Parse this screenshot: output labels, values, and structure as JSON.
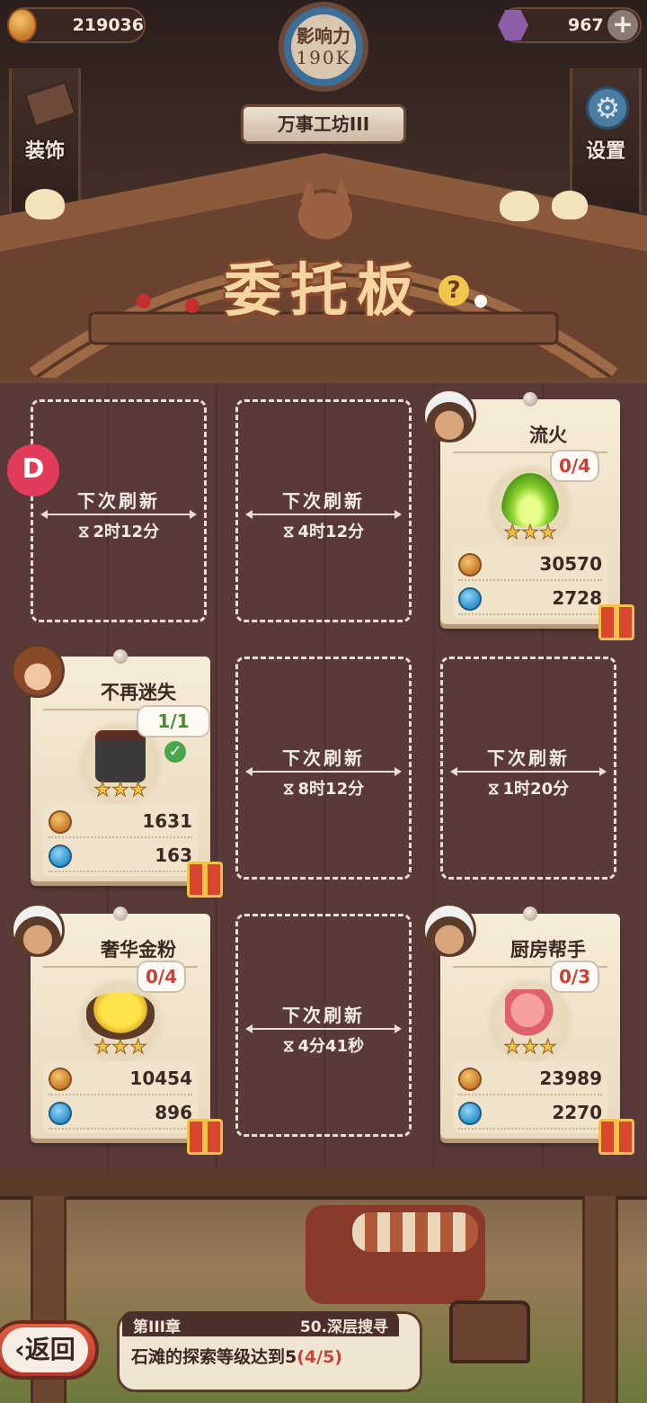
{
  "header": {
    "gold": "219036",
    "gems": "967",
    "influence_label": "影响力",
    "influence_value": "190K",
    "workshop_name": "万事工坊III",
    "decor_label": "装饰",
    "settings_label": "设置"
  },
  "board": {
    "title": "委托板",
    "help_icon": "?"
  },
  "slots": [
    {
      "type": "empty",
      "refresh_label": "下次刷新",
      "time": "2时12分"
    },
    {
      "type": "empty",
      "refresh_label": "下次刷新",
      "time": "4时12分"
    },
    {
      "type": "card",
      "title": "流火",
      "progress": "0/4",
      "gold": "30570",
      "reputation": "2728",
      "stars": 3,
      "item_icon": "green-fire-icon",
      "avatar": "chef"
    },
    {
      "type": "card",
      "title": "不再迷失",
      "progress": "1/1",
      "gold": "1631",
      "reputation": "163",
      "stars": 3,
      "item_icon": "ink-bottle-icon",
      "avatar": "boy",
      "complete": true
    },
    {
      "type": "empty",
      "refresh_label": "下次刷新",
      "time": "8时12分"
    },
    {
      "type": "empty",
      "refresh_label": "下次刷新",
      "time": "1时20分"
    },
    {
      "type": "card",
      "title": "奢华金粉",
      "progress": "0/4",
      "gold": "10454",
      "reputation": "896",
      "stars": 3,
      "item_icon": "gold-powder-icon",
      "avatar": "chef"
    },
    {
      "type": "empty",
      "refresh_label": "下次刷新",
      "time": "4分41秒"
    },
    {
      "type": "card",
      "title": "厨房帮手",
      "progress": "0/3",
      "gold": "23989",
      "reputation": "2270",
      "stars": 3,
      "item_icon": "seahorse-icon",
      "avatar": "chef"
    }
  ],
  "quest": {
    "chapter": "第III章",
    "name": "50.深层搜寻",
    "text": "石滩的探索等级达到5",
    "progress": "(4/5)"
  },
  "back_label": "返回",
  "colors": {
    "board_bg": "#5a3a38",
    "card_bg": "#f6ecd8",
    "title_gold": "#f5d6a3",
    "progress_red": "#c9413a",
    "complete_green": "#4aa64a"
  }
}
